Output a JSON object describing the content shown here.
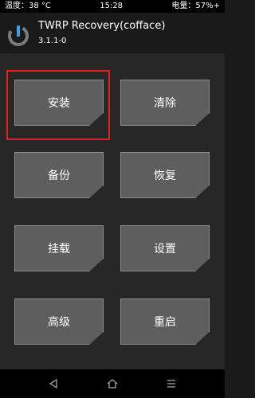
{
  "status_bar": {
    "temperature": "温度：38 °C",
    "time": "15:28",
    "battery": "电量：57%+"
  },
  "header": {
    "title": "TWRP Recovery(cofface)",
    "version": "3.1.1-0",
    "logo_icon": "twrp-logo-icon"
  },
  "menu": {
    "install": "安装",
    "wipe": "清除",
    "backup": "备份",
    "restore": "恢复",
    "mount": "挂载",
    "settings": "设置",
    "advanced": "高级",
    "reboot": "重启"
  },
  "nav": {
    "back_icon": "back-triangle-icon",
    "home_icon": "home-icon",
    "menu_icon": "menu-lines-icon"
  },
  "colors": {
    "tile_fill": "#5e5e5e",
    "tile_border": "#8f8f8f",
    "highlight": "#e02020",
    "background": "#272727"
  }
}
